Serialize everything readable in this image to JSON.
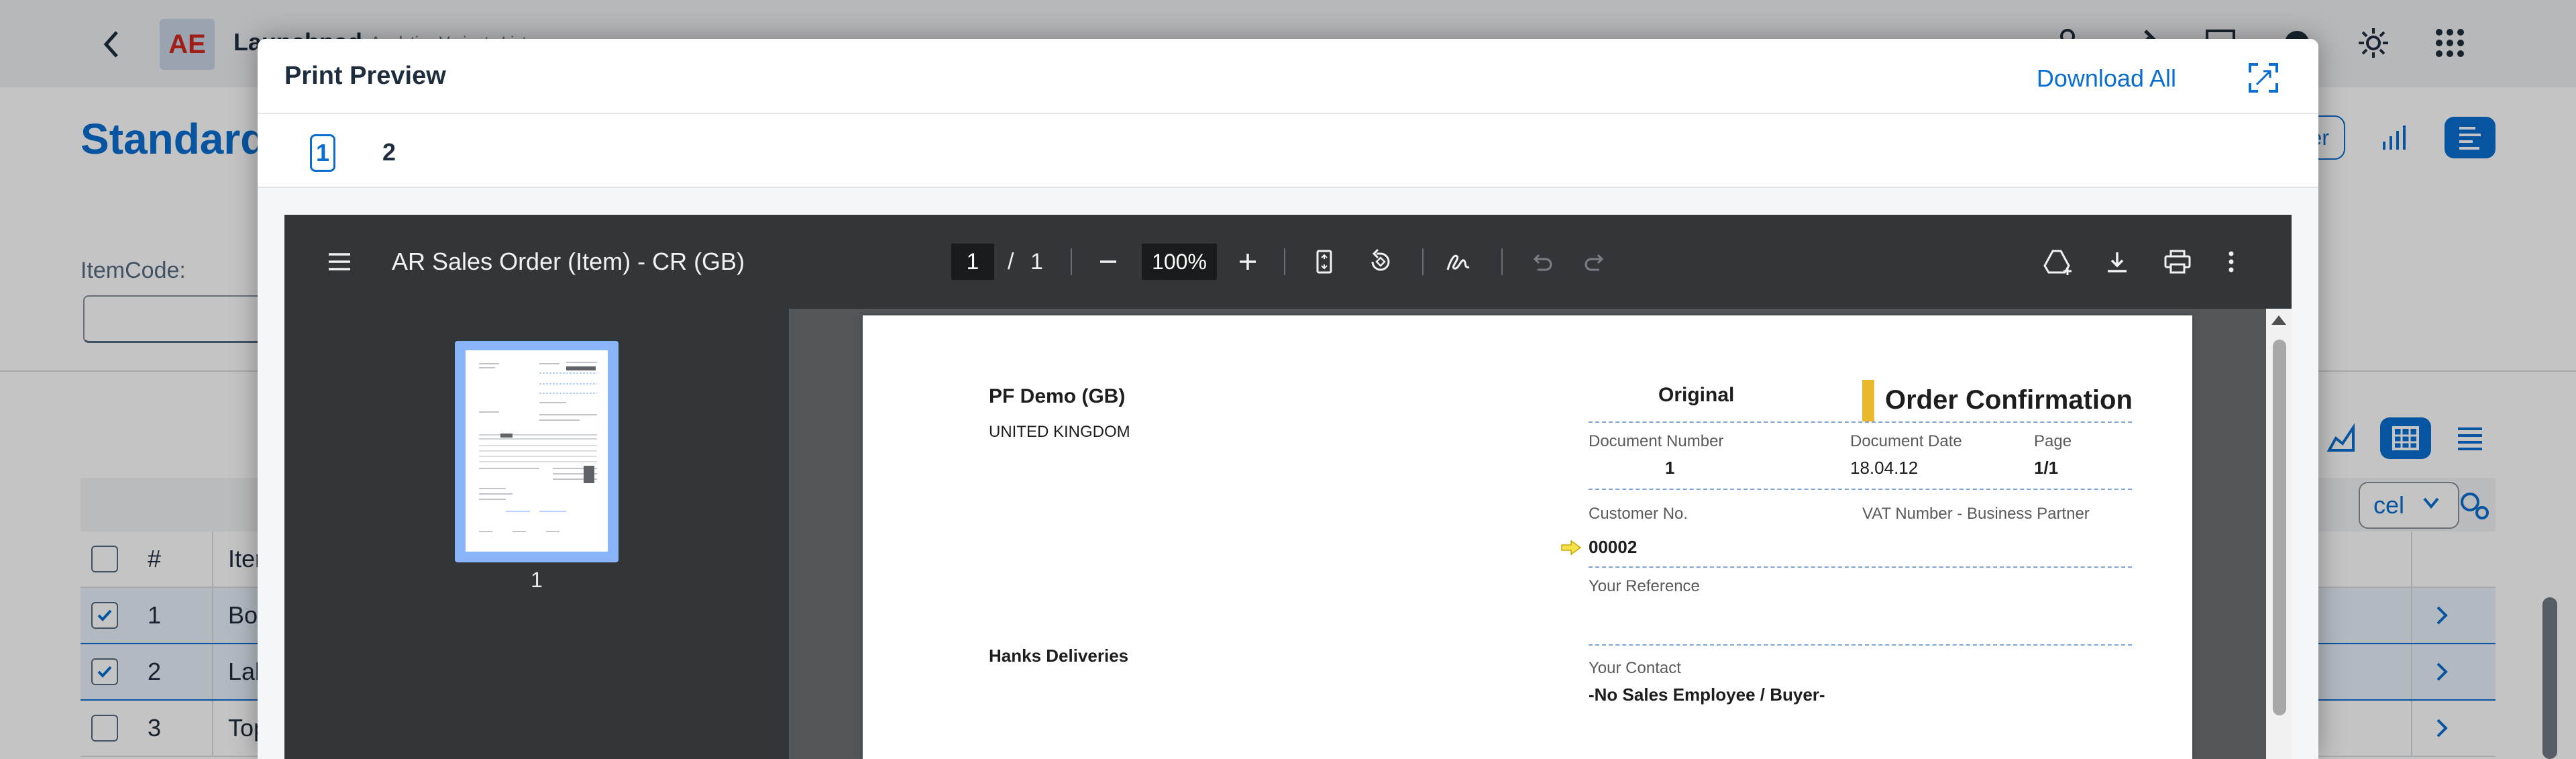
{
  "background": {
    "shell": {
      "logo_text": "AE",
      "app_name": "Launchpad",
      "app_subtitle": "Analytics Variants List"
    },
    "page_title": "Standard",
    "filter_chip_label": "ter",
    "filter_label": "ItemCode:",
    "export_label": "cel",
    "table": {
      "headers": {
        "number": "#",
        "item": "Iter"
      },
      "rows": [
        {
          "number": "1",
          "item": "Bo",
          "selected": true
        },
        {
          "number": "2",
          "item": "Lab",
          "selected": true
        },
        {
          "number": "3",
          "item": "Top",
          "selected": false
        }
      ]
    }
  },
  "dialog": {
    "title": "Print Preview",
    "download_all_label": "Download All",
    "tabs": [
      {
        "label": "1",
        "active": true
      },
      {
        "label": "2",
        "active": false
      }
    ]
  },
  "pdf_viewer": {
    "document_title": "AR Sales Order (Item) - CR (GB)",
    "current_page": "1",
    "page_separator": "/",
    "total_pages": "1",
    "zoom": "100%",
    "thumbnail_label": "1"
  },
  "document": {
    "company_name": "PF Demo (GB)",
    "company_country": "UNITED KINGDOM",
    "copy_type": "Original",
    "doc_title": "Order Confirmation",
    "document_number_label": "Document Number",
    "document_number": "1",
    "document_date_label": "Document Date",
    "document_date": "18.04.12",
    "page_label": "Page",
    "page_value": "1/1",
    "customer_no_label": "Customer No.",
    "customer_no": "00002",
    "vat_label": "VAT Number - Business Partner",
    "your_reference_label": "Your Reference",
    "ship_to_name": "Hanks Deliveries",
    "your_contact_label": "Your Contact",
    "your_contact": "-No Sales Employee / Buyer-"
  },
  "colors": {
    "accent": "#0a6ed1",
    "pdf_toolbar": "#323639",
    "pdf_background": "#525659",
    "thumbnail_highlight": "#8ab4f8",
    "doc_title_bar": "#e8b92d"
  }
}
